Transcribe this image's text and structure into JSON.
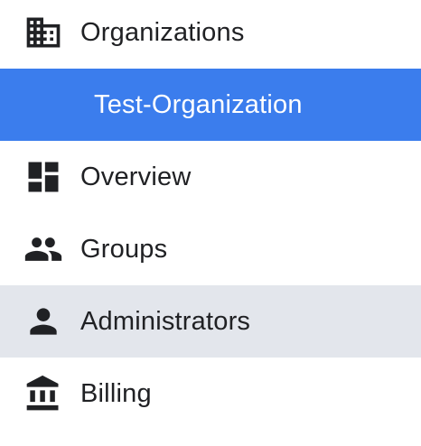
{
  "colors": {
    "selected_background": "#3b7ded",
    "hover_background": "#e3e6ec",
    "text": "#202124",
    "icon": "#202124"
  },
  "nav": {
    "items": [
      {
        "label": "Organizations",
        "icon": "domain-icon"
      },
      {
        "label": "Test-Organization",
        "icon": null,
        "selected": true
      },
      {
        "label": "Overview",
        "icon": "dashboard-icon"
      },
      {
        "label": "Groups",
        "icon": "people-icon"
      },
      {
        "label": "Administrators",
        "icon": "person-icon",
        "hovered": true
      },
      {
        "label": "Billing",
        "icon": "bank-icon"
      }
    ]
  }
}
